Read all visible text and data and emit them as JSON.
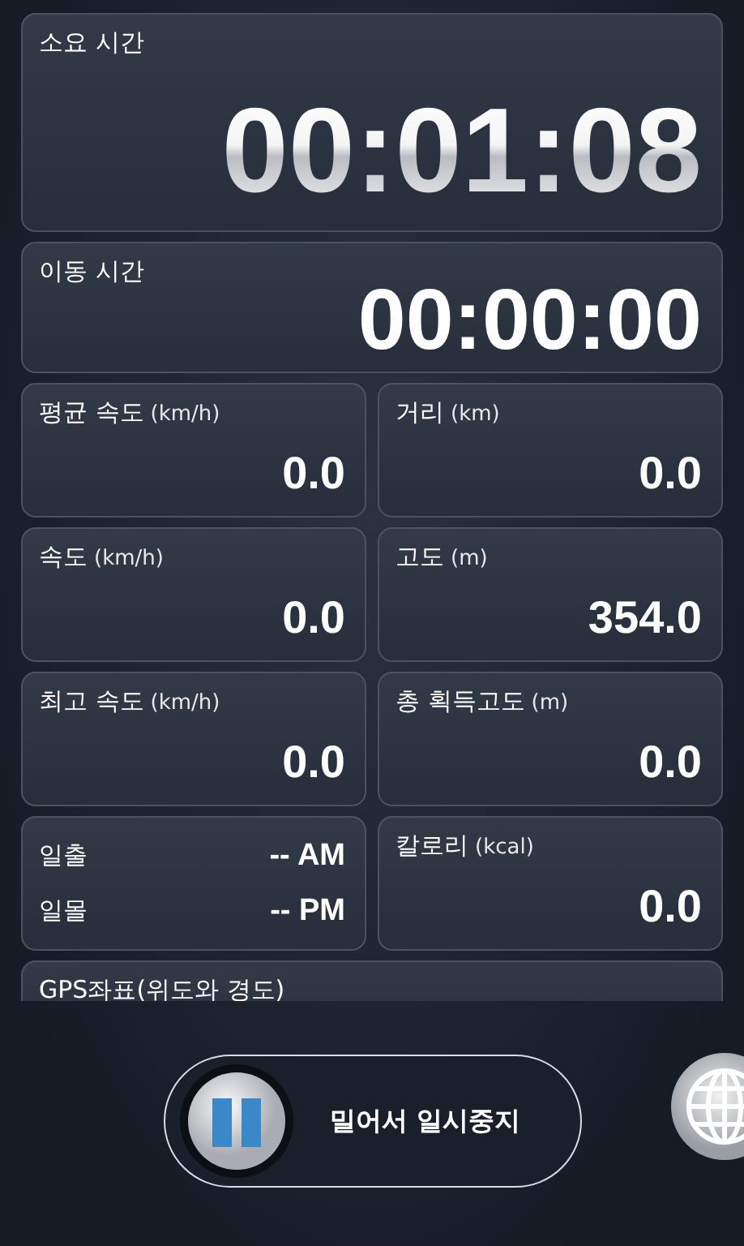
{
  "elapsed": {
    "label": "소요 시간",
    "value": "00:01:08"
  },
  "moving": {
    "label": "이동 시간",
    "value": "00:00:00"
  },
  "stats": [
    {
      "kind": "metric",
      "label": "평균 속도",
      "unit": "(km/h)",
      "value": "0.0"
    },
    {
      "kind": "metric",
      "label": "거리",
      "unit": "(km)",
      "value": "0.0"
    },
    {
      "kind": "metric",
      "label": "속도",
      "unit": "(km/h)",
      "value": "0.0"
    },
    {
      "kind": "metric",
      "label": "고도",
      "unit": "(m)",
      "value": "354.0"
    },
    {
      "kind": "metric",
      "label": "최고 속도",
      "unit": "(km/h)",
      "value": "0.0"
    },
    {
      "kind": "metric",
      "label": "총 획득고도",
      "unit": "(m)",
      "value": "0.0"
    },
    {
      "kind": "sun",
      "rows": [
        {
          "label": "일출",
          "value": "-- AM"
        },
        {
          "label": "일몰",
          "value": "-- PM"
        }
      ]
    },
    {
      "kind": "metric",
      "label": "칼로리",
      "unit": "(kcal)",
      "value": "0.0"
    }
  ],
  "gps": {
    "label": "GPS좌표(위도와 경도)"
  },
  "slider": {
    "label": "밀어서 일시중지",
    "level": 0
  }
}
